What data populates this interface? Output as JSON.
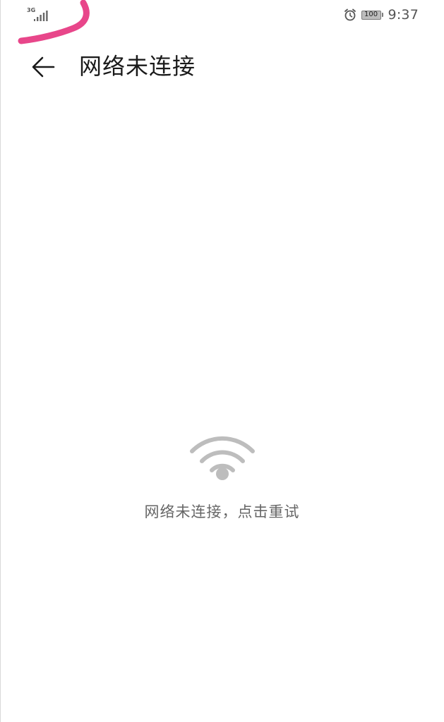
{
  "status_bar": {
    "network_type": "3G",
    "battery_level": "100",
    "time": "9:37",
    "icons": [
      "signal-icon",
      "alarm-icon",
      "battery-icon"
    ]
  },
  "header": {
    "back_icon": "back-arrow-icon",
    "title": "网络未连接"
  },
  "empty_state": {
    "icon": "wifi-icon",
    "message": "网络未连接，点击重试"
  },
  "colors": {
    "background": "#ffffff",
    "title_text": "#1a1a1a",
    "secondary_text": "#666666",
    "icon_gray": "#bdbdbd",
    "pen_annotation": "#e8468a"
  }
}
